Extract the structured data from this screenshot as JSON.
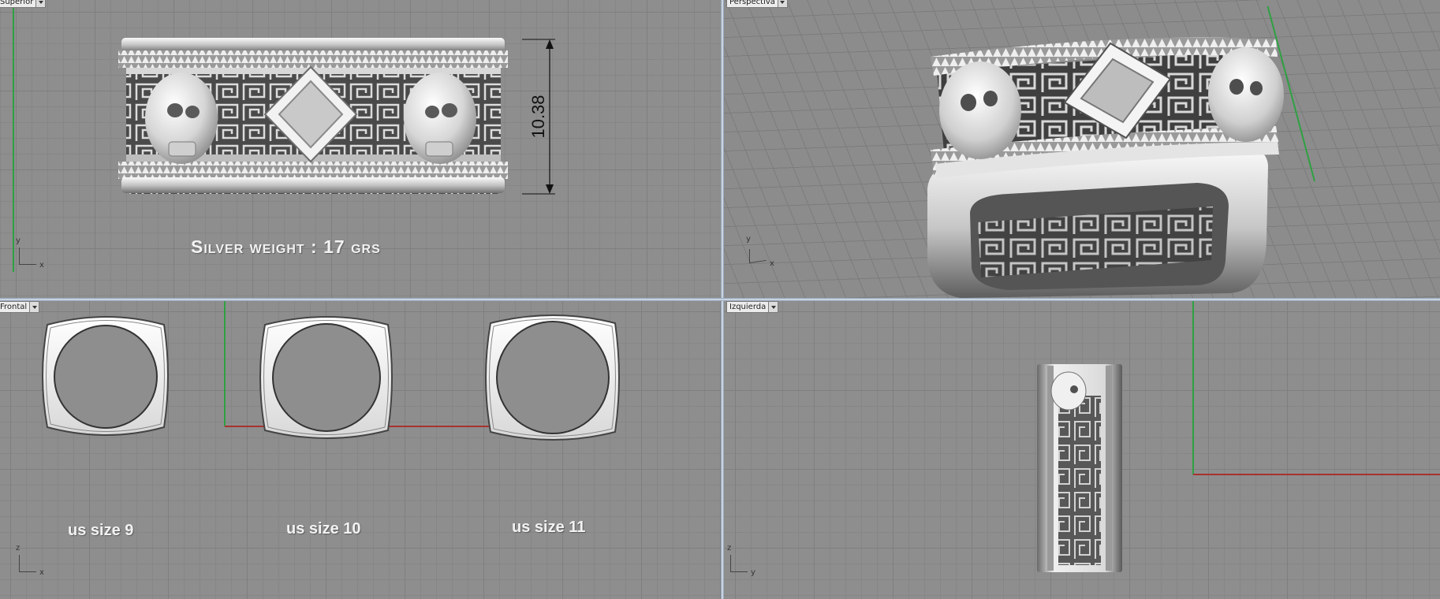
{
  "viewports": {
    "top": {
      "title": "Superior",
      "dimension": "10.38",
      "weight_caption": "Silver weight : 17 grs"
    },
    "perspective": {
      "title": "Perspectiva"
    },
    "front": {
      "title": "Frontal",
      "sizes": [
        "us size 9",
        "us size 10",
        "us size 11"
      ]
    },
    "left": {
      "title": "Izquierda"
    }
  },
  "axis_labels": {
    "x": "x",
    "y": "y",
    "z": "z"
  },
  "colors": {
    "x_axis": "#a8322f",
    "y_axis": "#2fa042",
    "background": "#8e8e8e",
    "model": "#e6e6e6"
  },
  "icons": {
    "viewport_menu": "chevron-down-icon",
    "axes": "axis-gizmo-icon"
  }
}
